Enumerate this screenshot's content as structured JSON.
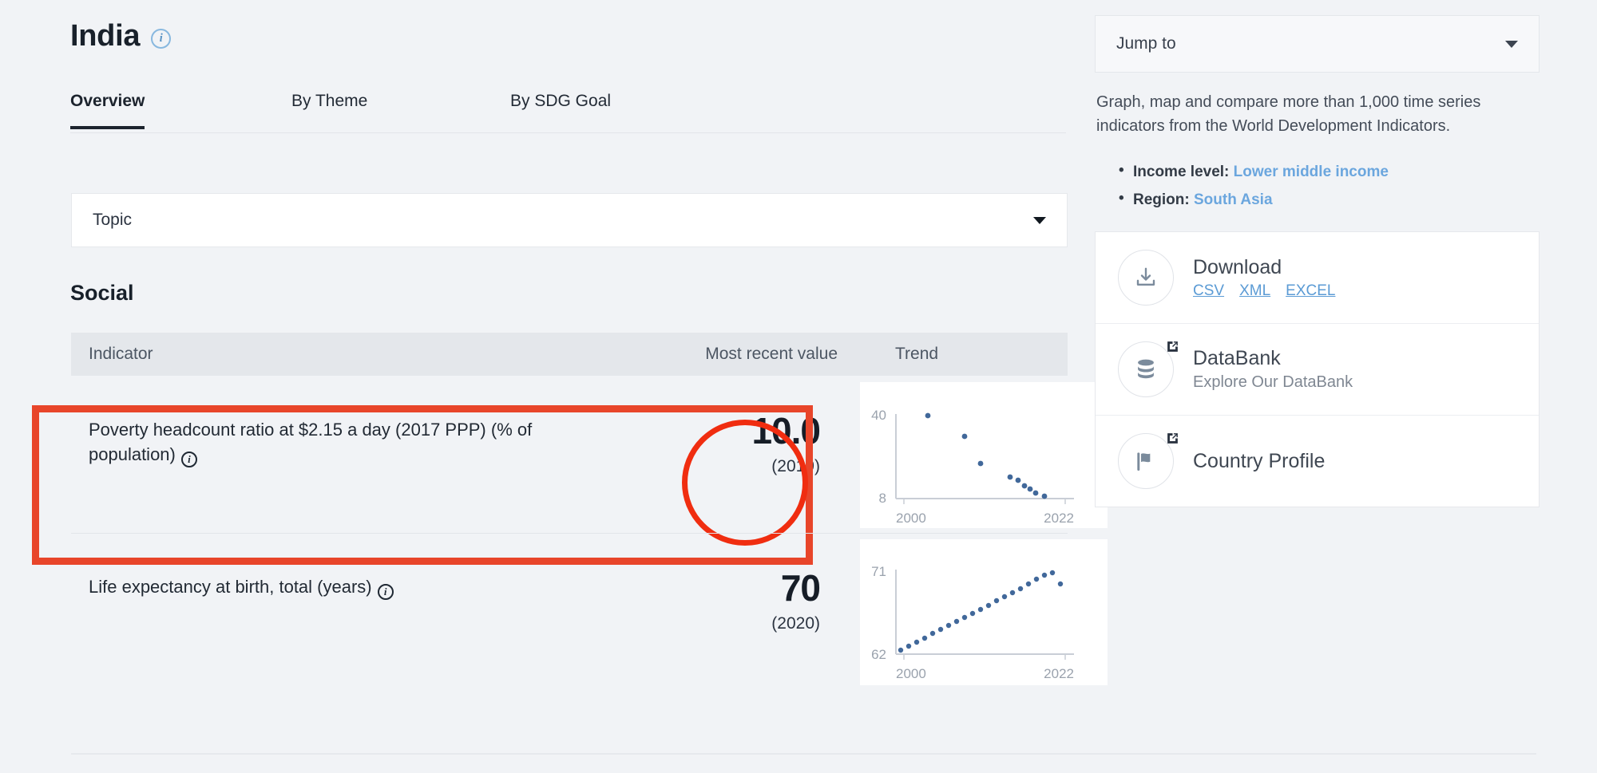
{
  "header": {
    "country": "India",
    "info_icon": "info-icon"
  },
  "tabs": [
    {
      "label": "Overview",
      "active": true
    },
    {
      "label": "By Theme",
      "active": false
    },
    {
      "label": "By SDG Goal",
      "active": false
    }
  ],
  "topic_select": {
    "label": "Topic",
    "caret_icon": "chevron-down-icon"
  },
  "section": {
    "title": "Social"
  },
  "table": {
    "columns": [
      "Indicator",
      "Most recent value",
      "Trend"
    ],
    "rows": [
      {
        "indicator": "Poverty headcount ratio at $2.15 a day (2017 PPP) (% of population)",
        "value": "10.0",
        "year": "(2019)",
        "highlighted": true
      },
      {
        "indicator": "Life expectancy at birth, total (years)",
        "value": "70",
        "year": "(2020)",
        "highlighted": false
      }
    ]
  },
  "chart_data": [
    {
      "type": "scatter",
      "title": "Poverty headcount ratio at $2.15 a day (2017 PPP) (% of population)",
      "xlabel": "",
      "ylabel": "",
      "x_ticks": [
        "2000",
        "2022"
      ],
      "y_ticks": [
        "8",
        "40"
      ],
      "xlim": [
        2000,
        2022
      ],
      "ylim": [
        8,
        40
      ],
      "grid": false,
      "legend": "none",
      "series": [
        {
          "name": "Poverty headcount ratio",
          "x": [
            2004,
            2009,
            2011,
            2015,
            2016,
            2017,
            2018,
            2019,
            2020
          ],
          "values": [
            39.9,
            31.0,
            22.9,
            16.2,
            15.4,
            13.0,
            11.8,
            10.0,
            9.2
          ]
        }
      ]
    },
    {
      "type": "scatter",
      "title": "Life expectancy at birth, total (years)",
      "xlabel": "",
      "ylabel": "",
      "x_ticks": [
        "2000",
        "2022"
      ],
      "y_ticks": [
        "62",
        "71"
      ],
      "xlim": [
        2000,
        2022
      ],
      "ylim": [
        62,
        71
      ],
      "grid": false,
      "legend": "none",
      "series": [
        {
          "name": "Life expectancy at birth",
          "x": [
            2000,
            2001,
            2002,
            2003,
            2004,
            2005,
            2006,
            2007,
            2008,
            2009,
            2010,
            2011,
            2012,
            2013,
            2014,
            2015,
            2016,
            2017,
            2018,
            2019,
            2020
          ],
          "values": [
            62.2,
            62.6,
            63.0,
            63.4,
            63.9,
            64.3,
            64.7,
            65.1,
            65.5,
            65.9,
            66.4,
            66.8,
            67.2,
            67.6,
            68.0,
            68.4,
            68.9,
            69.3,
            69.7,
            70.0,
            69.4
          ]
        }
      ]
    }
  ],
  "sidebar": {
    "jump_to": {
      "label": "Jump to",
      "caret_icon": "chevron-down-icon"
    },
    "blurb": "Graph, map and compare more than 1,000 time series indicators from the World Development Indicators.",
    "meta": [
      {
        "label": "Income level:",
        "value": "Lower middle income"
      },
      {
        "label": "Region:",
        "value": "South Asia"
      }
    ],
    "cards": [
      {
        "icon": "download-icon",
        "title": "Download",
        "links": [
          "CSV",
          "XML",
          "EXCEL"
        ]
      },
      {
        "icon": "database-icon",
        "title": "DataBank",
        "subtitle": "Explore Our DataBank",
        "external": true
      },
      {
        "icon": "flag-icon",
        "title": "Country Profile",
        "external": true
      }
    ]
  },
  "colors": {
    "page_bg": "#f1f3f6",
    "annotation_red": "#e8452a",
    "circle_red": "#f02d10",
    "link_blue": "#5b9bd5",
    "meta_link_blue": "#6ba6de",
    "spark_point": "#41689a",
    "header_row_bg": "#e4e7eb"
  }
}
